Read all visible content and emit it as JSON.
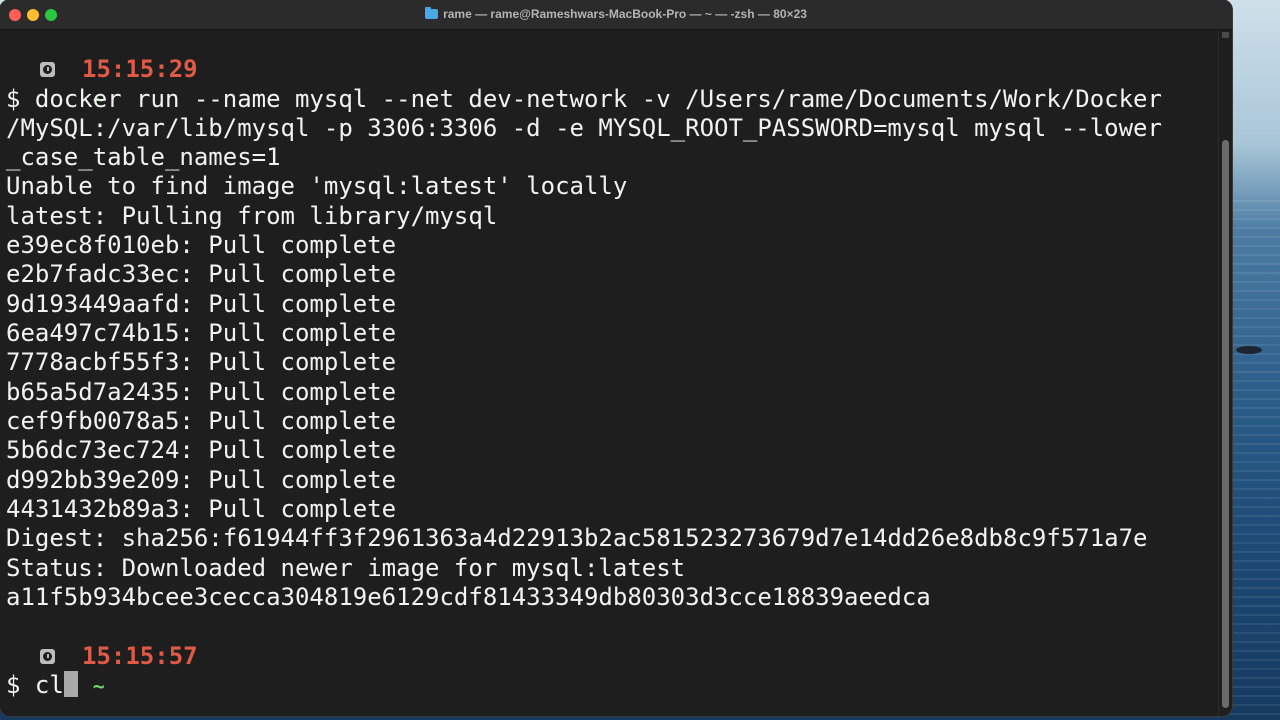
{
  "window": {
    "title": "rame — rame@Rameshwars-MacBook-Pro — ~ — -zsh — 80×23"
  },
  "icons": {
    "title": "folder-icon",
    "prompt_time": "clock-icon",
    "window_controls": [
      "close-icon",
      "minimize-icon",
      "zoom-icon"
    ]
  },
  "colors": {
    "time": "#e05a45",
    "tilde": "#6fd66b",
    "text": "#f2f2f2",
    "background": "#1e1e1e"
  },
  "terminal": {
    "prompt1": {
      "dir": "~",
      "time": "15:15:29"
    },
    "command_lines": [
      "$ docker run --name mysql --net dev-network -v /Users/rame/Documents/Work/Docker",
      "/MySQL:/var/lib/mysql -p 3306:3306 -d -e MYSQL_ROOT_PASSWORD=mysql mysql --lower",
      "_case_table_names=1"
    ],
    "output_lines": [
      "Unable to find image 'mysql:latest' locally",
      "latest: Pulling from library/mysql",
      "e39ec8f010eb: Pull complete",
      "e2b7fadc33ec: Pull complete",
      "9d193449aafd: Pull complete",
      "6ea497c74b15: Pull complete",
      "7778acbf55f3: Pull complete",
      "b65a5d7a2435: Pull complete",
      "cef9fb0078a5: Pull complete",
      "5b6dc73ec724: Pull complete",
      "d992bb39e209: Pull complete",
      "4431432b89a3: Pull complete",
      "Digest: sha256:f61944ff3f2961363a4d22913b2ac581523273679d7e14dd26e8db8c9f571a7e",
      "Status: Downloaded newer image for mysql:latest",
      "a11f5b934bcee3cecca304819e6129cdf81433349db80303d3cce18839aeedca"
    ],
    "prompt2": {
      "dir": "~",
      "time": "15:15:57"
    },
    "current_input": "$ cl"
  }
}
